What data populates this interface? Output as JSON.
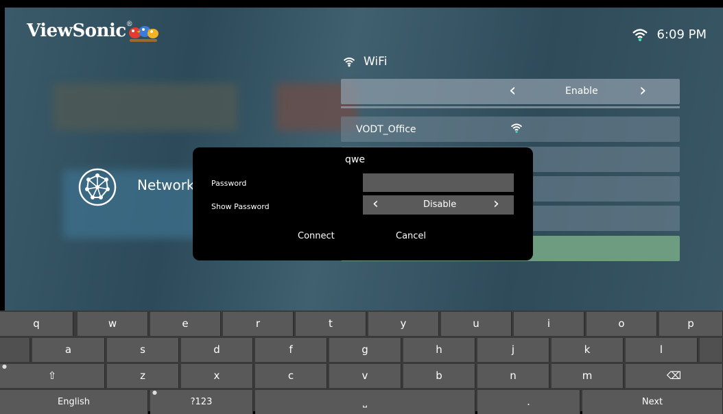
{
  "brand": {
    "name": "ViewSonic",
    "reg": "®"
  },
  "status": {
    "time": "6:09 PM",
    "icon": "wifi-icon"
  },
  "colors": {
    "accent_green": "#6e9c80",
    "dialog_bg": "#000000",
    "key_bg": "#595959"
  },
  "network": {
    "label": "Network"
  },
  "wifi": {
    "title": "WiFi",
    "toggle": {
      "value": "Enable"
    },
    "networks": [
      {
        "name": "VODT_Office",
        "icon": "wifi-signal-icon"
      }
    ]
  },
  "dialog": {
    "ssid": "qwe",
    "password_label": "Password",
    "password_value": "",
    "show_password_label": "Show Password",
    "show_password_value": "Disable",
    "connect_label": "Connect",
    "cancel_label": "Cancel"
  },
  "keyboard": {
    "row1": [
      "q",
      "w",
      "e",
      "r",
      "t",
      "y",
      "u",
      "i",
      "o",
      "p"
    ],
    "row2": [
      "a",
      "s",
      "d",
      "f",
      "g",
      "h",
      "j",
      "k",
      "l"
    ],
    "row3": [
      "⇧",
      "z",
      "x",
      "c",
      "v",
      "b",
      "n",
      "m",
      "⌫"
    ],
    "row4": {
      "lang": "English",
      "symbols": "?123",
      "space": "⎵",
      "period": ".",
      "next": "Next"
    }
  }
}
